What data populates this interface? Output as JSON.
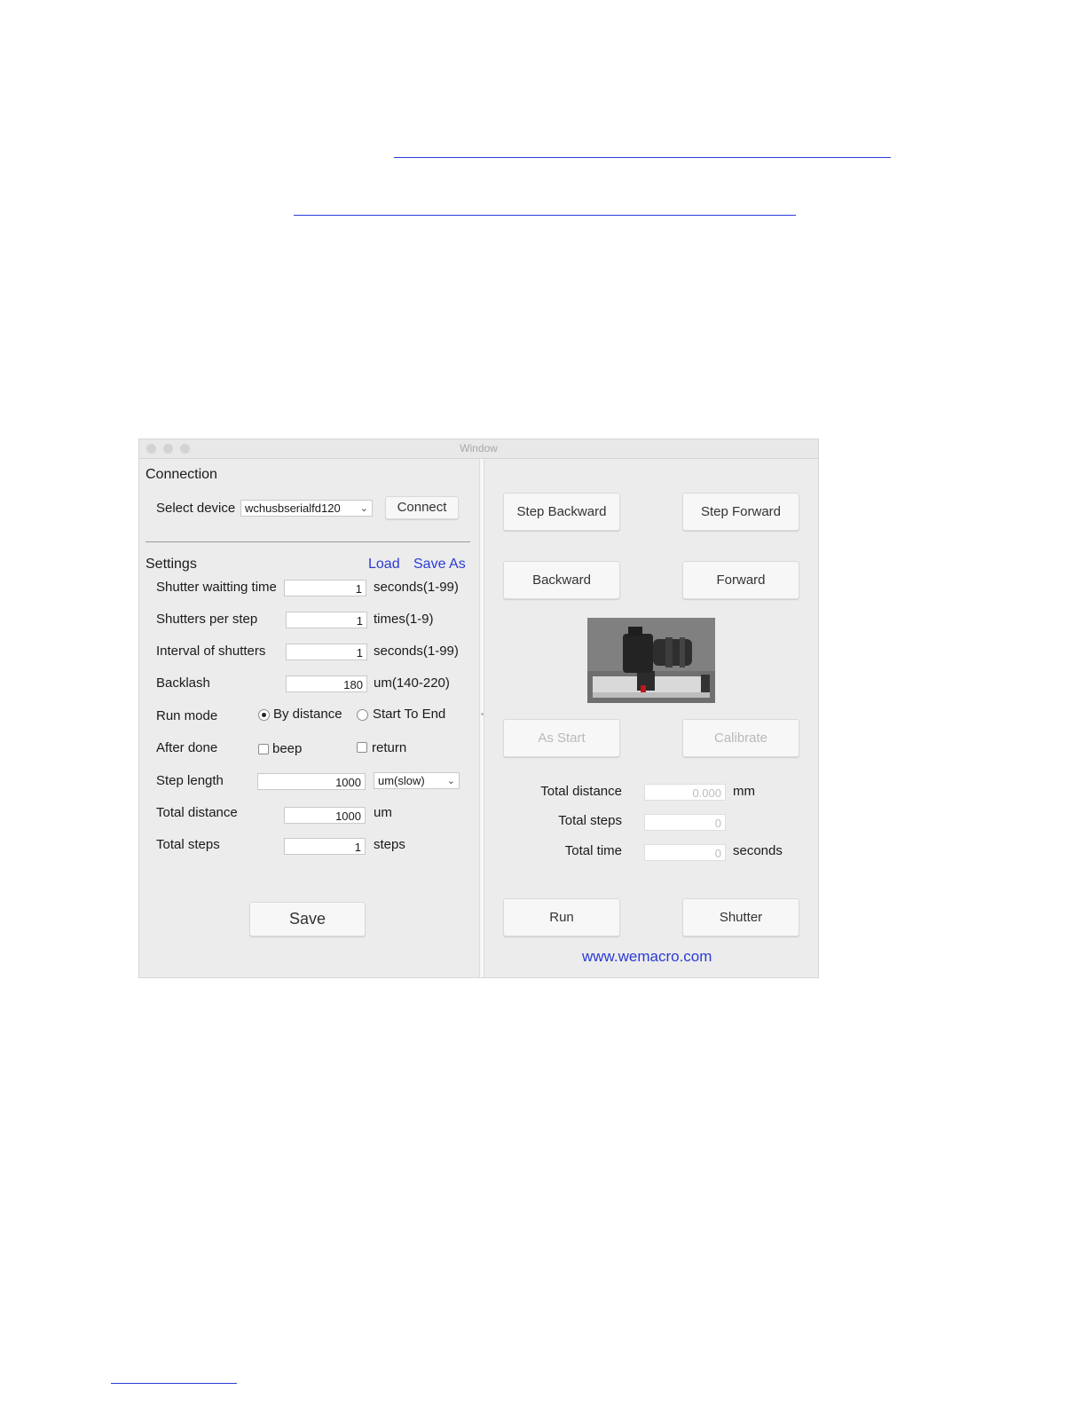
{
  "window": {
    "title": "Window"
  },
  "connection": {
    "heading": "Connection",
    "select_label": "Select device",
    "device_value": "wchusbserialfd120",
    "connect_label": "Connect"
  },
  "settings": {
    "heading": "Settings",
    "load_label": "Load",
    "save_as_label": "Save As",
    "shutter_wait": {
      "label": "Shutter waitting time",
      "value": "1",
      "unit": "seconds(1-99)"
    },
    "shutters_per_step": {
      "label": "Shutters per step",
      "value": "1",
      "unit": "times(1-9)"
    },
    "interval": {
      "label": "Interval of shutters",
      "value": "1",
      "unit": "seconds(1-99)"
    },
    "backlash": {
      "label": "Backlash",
      "value": "180",
      "unit": "um(140-220)"
    },
    "run_mode": {
      "label": "Run mode",
      "option1": "By distance",
      "option2": "Start To End",
      "selected": "By distance"
    },
    "after_done": {
      "label": "After done",
      "option1": "beep",
      "option2": "return"
    },
    "step_length": {
      "label": "Step length",
      "value": "1000",
      "unit_select": "um(slow)"
    },
    "total_distance": {
      "label": "Total distance",
      "value": "1000",
      "unit": "um"
    },
    "total_steps": {
      "label": "Total steps",
      "value": "1",
      "unit": "steps"
    },
    "save_label": "Save"
  },
  "controls": {
    "step_backward": "Step Backward",
    "step_forward": "Step Forward",
    "backward": "Backward",
    "forward": "Forward",
    "as_start": "As Start",
    "calibrate": "Calibrate",
    "run": "Run",
    "shutter": "Shutter"
  },
  "status": {
    "total_distance": {
      "label": "Total distance",
      "value": "0.000",
      "unit": "mm"
    },
    "total_steps": {
      "label": "Total steps",
      "value": "0"
    },
    "total_time": {
      "label": "Total time",
      "value": "0",
      "unit": "seconds"
    }
  },
  "footer": {
    "website": "www.wemacro.com"
  },
  "colors": {
    "link": "#2a3bd6",
    "window_bg": "#ececec",
    "button_bg": "#f7f7f7"
  },
  "icons": {
    "select_caret": "chevron-down-icon",
    "traffic_lights": "window-control-icon"
  }
}
